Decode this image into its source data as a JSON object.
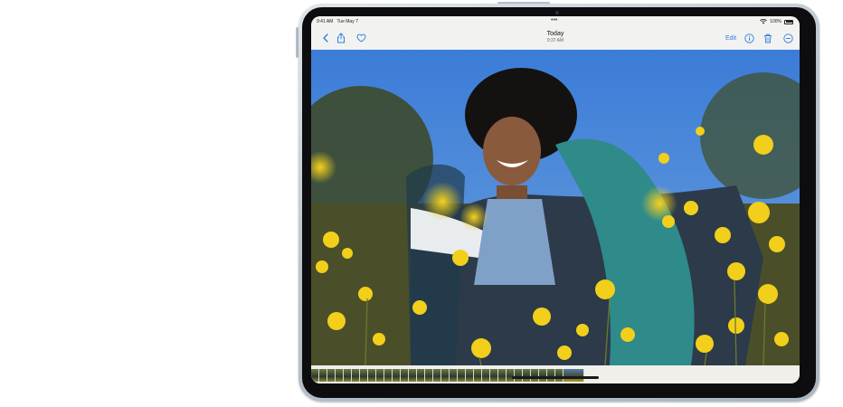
{
  "status": {
    "time": "9:41 AM",
    "date": "Tue May 7",
    "battery": "100%"
  },
  "nav": {
    "title": "Today",
    "subtitle": "9:37 AM",
    "edit_label": "Edit"
  },
  "icons": [
    "back-chevron-icon",
    "share-icon",
    "heart-icon",
    "info-icon",
    "trash-icon",
    "more-icon",
    "wifi-icon",
    "battery-icon"
  ],
  "colors": {
    "accent": "#2f7de1",
    "sky": "#3f7fd6",
    "flowers": "#e8c417"
  }
}
